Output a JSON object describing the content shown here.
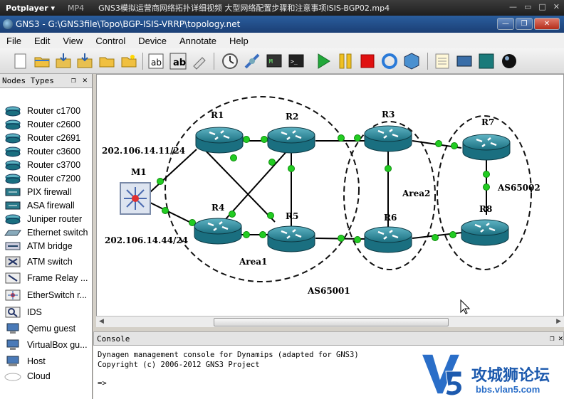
{
  "potplayer": {
    "brand": "Potplayer ▾",
    "tab": "MP4",
    "title": "GNS3模拟运营商网络拓扑详细视频 大型网络配置步骤和注意事项ISIS-BGP02.mp4",
    "controls": [
      "—",
      "▭",
      "□",
      "✕"
    ]
  },
  "window": {
    "title": "GNS3 - G:\\GNS3file\\Topo\\BGP-ISIS-VRRP\\topology.net",
    "minimize": "—",
    "restore": "❐",
    "close": "✕"
  },
  "menu": [
    "File",
    "Edit",
    "View",
    "Control",
    "Device",
    "Annotate",
    "Help"
  ],
  "nodes_panel": {
    "title": "Nodes Types",
    "float_icon": "❐",
    "close_icon": "✕",
    "items": [
      {
        "label": "Router c1700",
        "icon": "router-icon"
      },
      {
        "label": "Router c2600",
        "icon": "router-icon"
      },
      {
        "label": "Router c2691",
        "icon": "router-icon"
      },
      {
        "label": "Router c3600",
        "icon": "router-icon"
      },
      {
        "label": "Router c3700",
        "icon": "router-icon"
      },
      {
        "label": "Router c7200",
        "icon": "router-icon"
      },
      {
        "label": "PIX firewall",
        "icon": "firewall-icon"
      },
      {
        "label": "ASA firewall",
        "icon": "firewall-icon"
      },
      {
        "label": "Juniper router",
        "icon": "router-icon"
      },
      {
        "label": "Ethernet switch",
        "icon": "switch-icon"
      },
      {
        "label": "ATM bridge",
        "icon": "atm-bridge-icon"
      },
      {
        "label": "ATM switch",
        "icon": "atm-switch-icon"
      },
      {
        "label": "Frame Relay ...",
        "icon": "frame-relay-icon"
      },
      {
        "label": "EtherSwitch r...",
        "icon": "etherswitch-icon"
      },
      {
        "label": "IDS",
        "icon": "ids-icon"
      },
      {
        "label": "Qemu guest",
        "icon": "computer-icon"
      },
      {
        "label": "VirtualBox gu...",
        "icon": "computer-icon"
      },
      {
        "label": "Host",
        "icon": "host-icon"
      },
      {
        "label": "Cloud",
        "icon": "cloud-icon"
      }
    ]
  },
  "topology": {
    "routers": [
      {
        "id": "r1",
        "label": "R1"
      },
      {
        "id": "r2",
        "label": "R2"
      },
      {
        "id": "r3",
        "label": "R3"
      },
      {
        "id": "r4",
        "label": "R4"
      },
      {
        "id": "r5",
        "label": "R5"
      },
      {
        "id": "r6",
        "label": "R6"
      },
      {
        "id": "r7",
        "label": "R7"
      },
      {
        "id": "r8",
        "label": "R8"
      }
    ],
    "switch_label": "M1",
    "ip_top": "202.106.14.11/24",
    "ip_bottom": "202.106.14.44/24",
    "area1": "Area1",
    "area2": "Area2",
    "as_left": "AS65001",
    "as_right": "AS65002"
  },
  "console": {
    "title": "Console",
    "float_icon": "❐",
    "close_icon": "✕",
    "line1": "Dynagen management console for Dynamips (adapted for GNS3)",
    "line2": "Copyright (c) 2006-2012 GNS3 Project",
    "prompt": "=>"
  },
  "watermark": {
    "brand_cn": "攻城狮论坛",
    "url": "bbs.vlan5.com"
  },
  "colors": {
    "link_dot": "#22cc22",
    "router_body": "#1f7f92",
    "title_blue": "#1b3f75"
  }
}
